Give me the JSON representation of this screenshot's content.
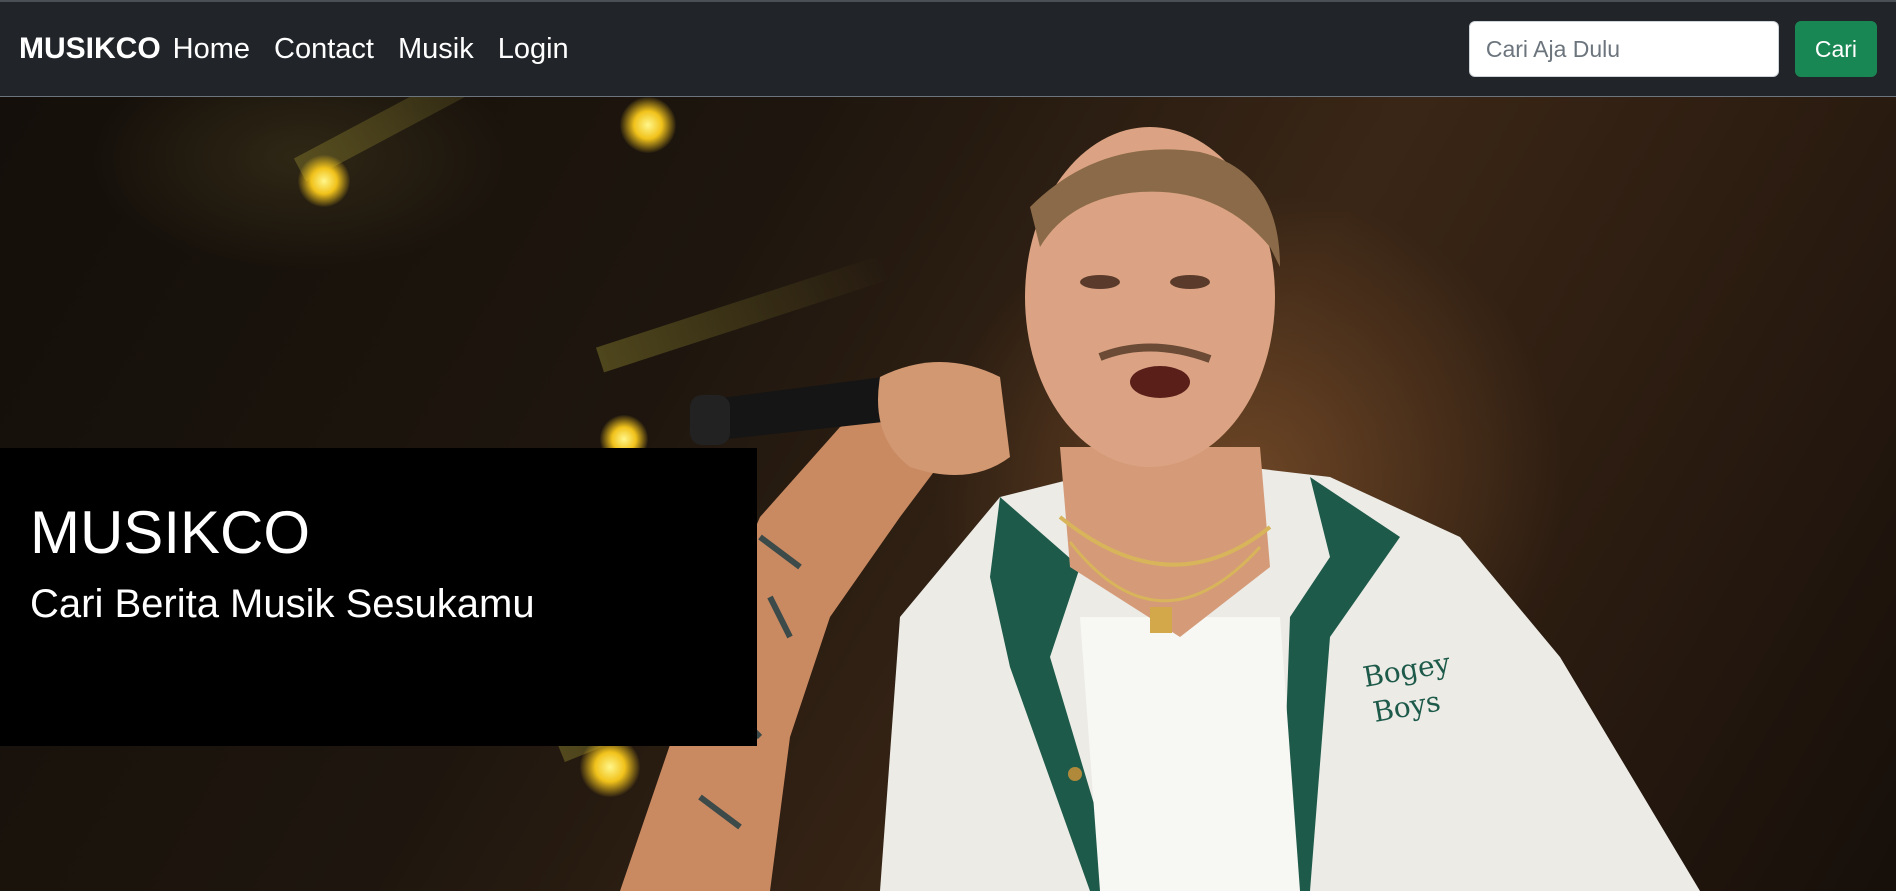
{
  "navbar": {
    "brand": "MUSIKCO",
    "links": [
      {
        "label": "Home"
      },
      {
        "label": "Contact"
      },
      {
        "label": "Musik"
      },
      {
        "label": "Login"
      }
    ],
    "search": {
      "placeholder": "Cari Aja Dulu",
      "button_label": "Cari"
    }
  },
  "hero": {
    "image_icon": "concert-singer-photo",
    "caption": {
      "title": "MUSIKCO",
      "subtitle": "Cari Berita Musik Sesukamu"
    }
  },
  "colors": {
    "navbar_bg": "#212529",
    "search_button": "#198754",
    "caption_bg": "#000000"
  }
}
